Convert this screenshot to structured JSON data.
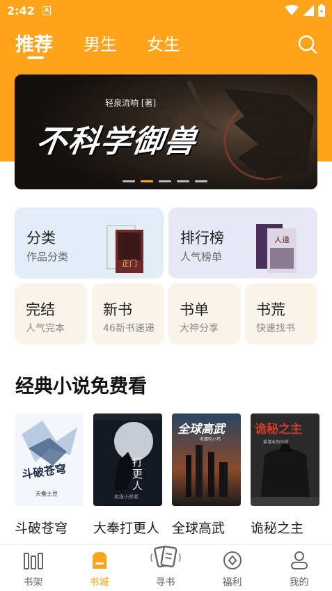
{
  "status": {
    "time": "2:42",
    "notif_letter": "A"
  },
  "tabs": [
    {
      "label": "推荐",
      "active": true
    },
    {
      "label": "男生",
      "active": false
    },
    {
      "label": "女生",
      "active": false
    }
  ],
  "banner": {
    "author": "轻泉流响 [著]",
    "title": "不科学御兽",
    "page_count": 5,
    "active_page": 2
  },
  "categories": [
    {
      "title": "分类",
      "subtitle": "作品分类"
    },
    {
      "title": "排行榜",
      "subtitle": "人气榜单"
    },
    {
      "title": "完结",
      "subtitle": "人气完本"
    },
    {
      "title": "新书",
      "subtitle": "46新书速递"
    },
    {
      "title": "书单",
      "subtitle": "大神分享"
    },
    {
      "title": "书荒",
      "subtitle": "快速找书"
    }
  ],
  "section": {
    "title": "经典小说免费看"
  },
  "books": [
    {
      "name": "斗破苍穹",
      "cover_text": "斗破苍穹",
      "cover_author": "天蚕土豆"
    },
    {
      "name": "大奉打更人",
      "cover_text": "打更人",
      "cover_author": "卖报小郎君"
    },
    {
      "name": "全球高武",
      "cover_text": "全球高武",
      "cover_author": "老鹰吃小鸡"
    },
    {
      "name": "诡秘之主",
      "cover_text": "诡秘之主",
      "cover_author": "爱潜水的乌贼"
    }
  ],
  "bottom_nav": [
    {
      "label": "书架",
      "icon": "bookshelf-icon",
      "active": false
    },
    {
      "label": "书城",
      "icon": "bookstore-icon",
      "active": true
    },
    {
      "label": "寻书",
      "icon": "find-book-icon",
      "active": false
    },
    {
      "label": "福利",
      "icon": "welfare-icon",
      "active": false
    },
    {
      "label": "我的",
      "icon": "profile-icon",
      "active": false
    }
  ],
  "colors": {
    "accent": "#FFA31A",
    "card_blue": "#E2EDF7",
    "card_purple": "#E7E7F6",
    "card_cream": "#FBF4EA"
  }
}
